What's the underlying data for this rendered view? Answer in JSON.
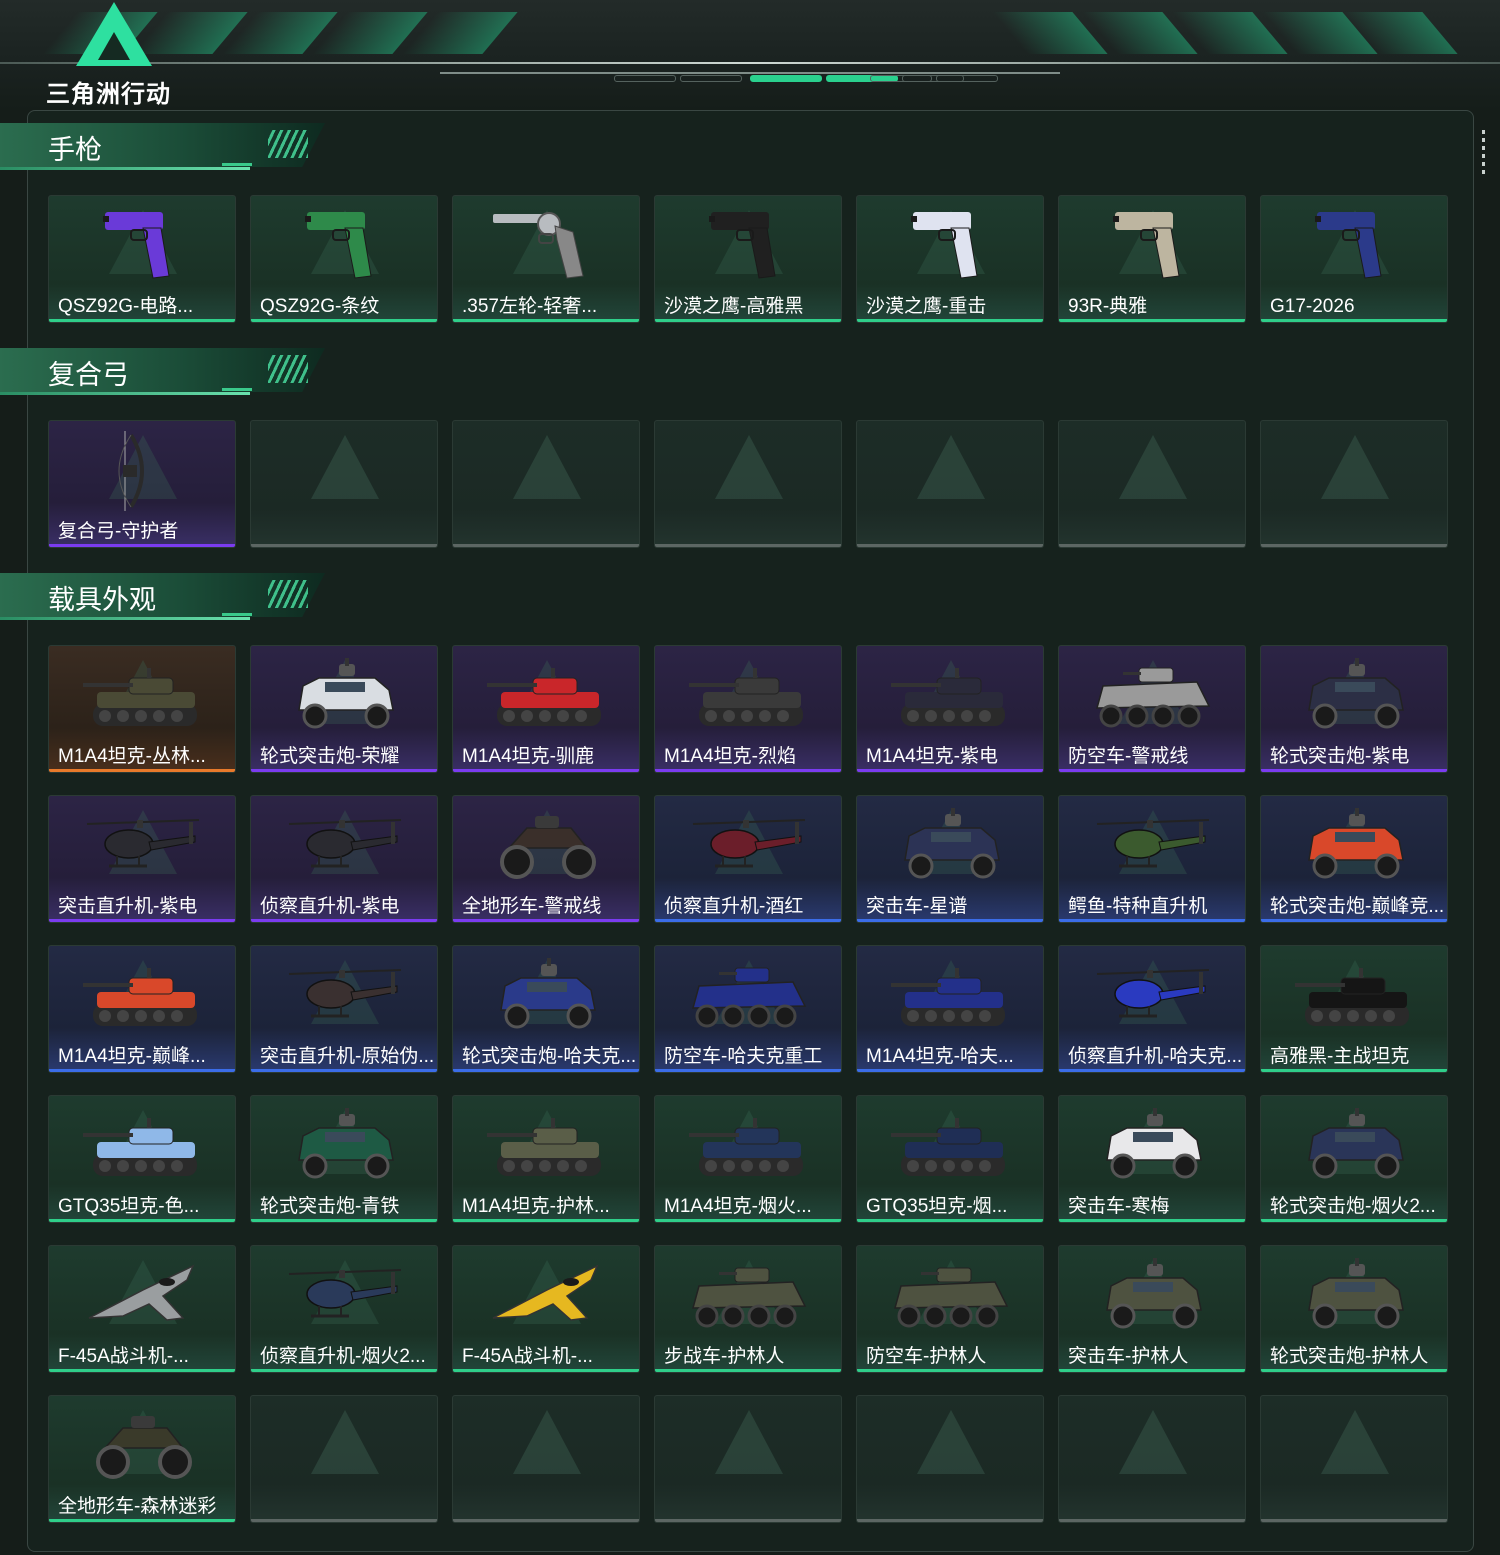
{
  "app": {
    "logo_text": "三角洲行动",
    "header_nav_pills": 7,
    "active_pills": [
      2,
      3
    ],
    "accent_color": "#2fcf8a",
    "rarity_colors": {
      "green": "#2fcf8a",
      "purple": "#7b3cf0",
      "blue": "#3b6de8",
      "orange": "#e87a2b",
      "empty": "#5c6663"
    }
  },
  "sections": [
    {
      "title": "手枪",
      "items": [
        {
          "label": "QSZ92G-电路...",
          "rarity": "green",
          "icon": "pistol-icon",
          "color": "#6a3ad8"
        },
        {
          "label": "QSZ92G-条纹",
          "rarity": "green",
          "icon": "pistol-icon",
          "color": "#2e8a4a"
        },
        {
          "label": ".357左轮-轻奢...",
          "rarity": "green",
          "icon": "revolver-icon",
          "color": "#b8bcc0"
        },
        {
          "label": "沙漠之鹰-高雅黑",
          "rarity": "green",
          "icon": "pistol-icon",
          "color": "#202020"
        },
        {
          "label": "沙漠之鹰-重击",
          "rarity": "green",
          "icon": "pistol-icon",
          "color": "#dfe3f0"
        },
        {
          "label": "93R-典雅",
          "rarity": "green",
          "icon": "pistol-icon",
          "color": "#bdb5a0"
        },
        {
          "label": "G17-2026",
          "rarity": "green",
          "icon": "pistol-icon",
          "color": "#2b3a8a"
        }
      ]
    },
    {
      "title": "复合弓",
      "items": [
        {
          "label": "复合弓-守护者",
          "rarity": "purple",
          "icon": "bow-icon",
          "color": "#2a2a2a"
        },
        {
          "label": "",
          "rarity": "empty"
        },
        {
          "label": "",
          "rarity": "empty"
        },
        {
          "label": "",
          "rarity": "empty"
        },
        {
          "label": "",
          "rarity": "empty"
        },
        {
          "label": "",
          "rarity": "empty"
        },
        {
          "label": "",
          "rarity": "empty"
        }
      ]
    },
    {
      "title": "载具外观",
      "items": [
        {
          "label": "M1A4坦克-丛林...",
          "rarity": "orange",
          "icon": "tank-icon",
          "color": "#4a4a35"
        },
        {
          "label": "轮式突击炮-荣耀",
          "rarity": "purple",
          "icon": "armored-car-icon",
          "color": "#d9dde2"
        },
        {
          "label": "M1A4坦克-驯鹿",
          "rarity": "purple",
          "icon": "tank-icon",
          "color": "#c9262a"
        },
        {
          "label": "M1A4坦克-烈焰",
          "rarity": "purple",
          "icon": "tank-icon",
          "color": "#3a3a3a"
        },
        {
          "label": "M1A4坦克-紫电",
          "rarity": "purple",
          "icon": "tank-icon",
          "color": "#2a2a3a"
        },
        {
          "label": "防空车-警戒线",
          "rarity": "purple",
          "icon": "apc-icon",
          "color": "#9a9a9a"
        },
        {
          "label": "轮式突击炮-紫电",
          "rarity": "purple",
          "icon": "armored-car-icon",
          "color": "#2c2f45"
        },
        {
          "label": "突击直升机-紫电",
          "rarity": "purple",
          "icon": "helicopter-icon",
          "color": "#2a2a30"
        },
        {
          "label": "侦察直升机-紫电",
          "rarity": "purple",
          "icon": "helicopter-icon",
          "color": "#2a2a30"
        },
        {
          "label": "全地形车-警戒线",
          "rarity": "purple",
          "icon": "atv-icon",
          "color": "#3a2f2a"
        },
        {
          "label": "侦察直升机-酒红",
          "rarity": "blue",
          "icon": "helicopter-icon",
          "color": "#6b1e2a"
        },
        {
          "label": "突击车-星谱",
          "rarity": "blue",
          "icon": "armored-car-icon",
          "color": "#2c3355"
        },
        {
          "label": "鳄鱼-特种直升机",
          "rarity": "blue",
          "icon": "helicopter-icon",
          "color": "#3b5a2e"
        },
        {
          "label": "轮式突击炮-巅峰竞...",
          "rarity": "blue",
          "icon": "armored-car-icon",
          "color": "#d9482a"
        },
        {
          "label": "M1A4坦克-巅峰...",
          "rarity": "blue",
          "icon": "tank-icon",
          "color": "#d9482a"
        },
        {
          "label": "突击直升机-原始伪...",
          "rarity": "blue",
          "icon": "helicopter-icon",
          "color": "#3a3030"
        },
        {
          "label": "轮式突击炮-哈夫克...",
          "rarity": "blue",
          "icon": "armored-car-icon",
          "color": "#2a3a8a"
        },
        {
          "label": "防空车-哈夫克重工",
          "rarity": "blue",
          "icon": "apc-icon",
          "color": "#23308a"
        },
        {
          "label": "M1A4坦克-哈夫...",
          "rarity": "blue",
          "icon": "tank-icon",
          "color": "#23308a"
        },
        {
          "label": "侦察直升机-哈夫克...",
          "rarity": "blue",
          "icon": "helicopter-icon",
          "color": "#2a3ac0"
        },
        {
          "label": "高雅黑-主战坦克",
          "rarity": "green",
          "icon": "tank-icon",
          "color": "#151515"
        },
        {
          "label": "GTQ35坦克-色...",
          "rarity": "green",
          "icon": "tank-icon",
          "color": "#8fb8e8"
        },
        {
          "label": "轮式突击炮-青铁",
          "rarity": "green",
          "icon": "armored-car-icon",
          "color": "#1e5a44"
        },
        {
          "label": "M1A4坦克-护林...",
          "rarity": "green",
          "icon": "tank-icon",
          "color": "#5a5e48"
        },
        {
          "label": "M1A4坦克-烟火...",
          "rarity": "green",
          "icon": "tank-icon",
          "color": "#23355a"
        },
        {
          "label": "GTQ35坦克-烟...",
          "rarity": "green",
          "icon": "tank-icon",
          "color": "#1f2e55"
        },
        {
          "label": "突击车-寒梅",
          "rarity": "green",
          "icon": "armored-car-icon",
          "color": "#e8e8ea"
        },
        {
          "label": "轮式突击炮-烟火2...",
          "rarity": "green",
          "icon": "armored-car-icon",
          "color": "#2a3558"
        },
        {
          "label": "F-45A战斗机-...",
          "rarity": "green",
          "icon": "fighter-jet-icon",
          "color": "#9a9ea0"
        },
        {
          "label": "侦察直升机-烟火2...",
          "rarity": "green",
          "icon": "helicopter-icon",
          "color": "#2a3a5a"
        },
        {
          "label": "F-45A战斗机-...",
          "rarity": "green",
          "icon": "fighter-jet-icon",
          "color": "#e6b820"
        },
        {
          "label": "步战车-护林人",
          "rarity": "green",
          "icon": "apc-icon",
          "color": "#4e5240"
        },
        {
          "label": "防空车-护林人",
          "rarity": "green",
          "icon": "apc-icon",
          "color": "#4e5240"
        },
        {
          "label": "突击车-护林人",
          "rarity": "green",
          "icon": "armored-car-icon",
          "color": "#4e5240"
        },
        {
          "label": "轮式突击炮-护林人",
          "rarity": "green",
          "icon": "armored-car-icon",
          "color": "#4e5240"
        },
        {
          "label": "全地形车-森林迷彩",
          "rarity": "green",
          "icon": "atv-icon",
          "color": "#3a3a2a"
        },
        {
          "label": "",
          "rarity": "empty"
        },
        {
          "label": "",
          "rarity": "empty"
        },
        {
          "label": "",
          "rarity": "empty"
        },
        {
          "label": "",
          "rarity": "empty"
        },
        {
          "label": "",
          "rarity": "empty"
        },
        {
          "label": "",
          "rarity": "empty"
        }
      ]
    }
  ]
}
